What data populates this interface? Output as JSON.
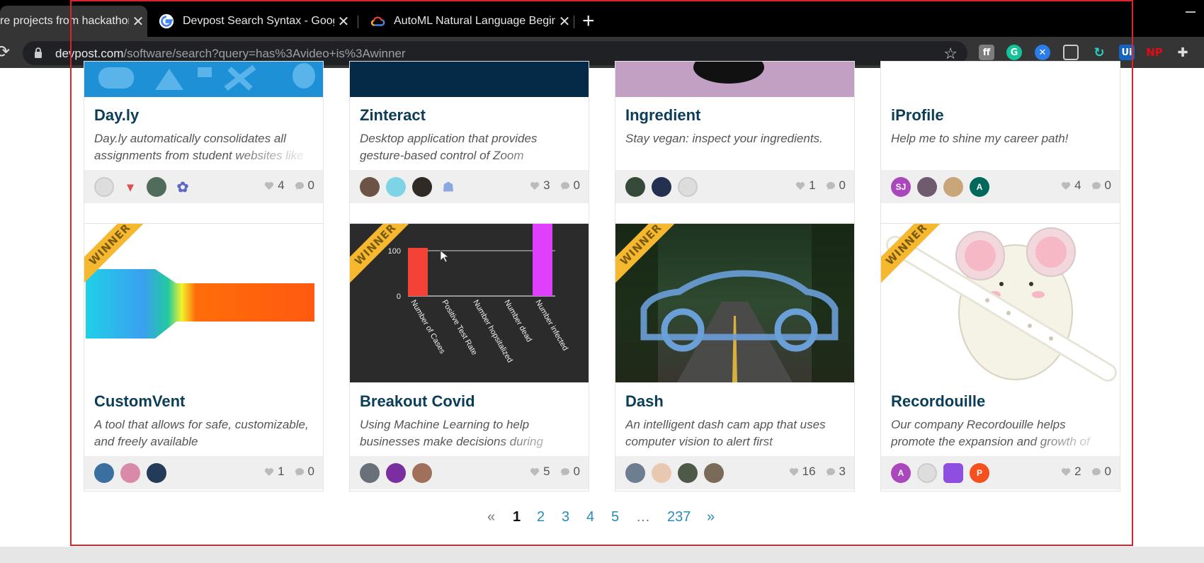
{
  "browser": {
    "tabs": [
      {
        "title": "re projects from hackathon",
        "close": "✕"
      },
      {
        "title": "Devpost Search Syntax - Google",
        "close": "✕"
      },
      {
        "title": "AutoML Natural Language Beginner",
        "close": "✕"
      }
    ],
    "new_tab": "+",
    "url_host": "devpost.com",
    "url_path": "/software/search?query=has%3Avideo+is%3Awinner",
    "extensions": [
      "hackathon-ext-icon",
      "grammarly-icon",
      "x-extension-icon",
      "wallet-icon",
      "sync-icon",
      "ui-ext-icon",
      "netflix-party-icon",
      "puzzle-icon"
    ],
    "ext_labels": {
      "ui": "Ui",
      "np": "NP"
    }
  },
  "ribbon_text": "WINNER",
  "projects": [
    {
      "title": "Day.ly",
      "tagline": "Day.ly automatically consolidates all assignments from student websites like",
      "likes": "4",
      "comments": "0",
      "winner": false
    },
    {
      "title": "Zinteract",
      "tagline": "Desktop application that provides gesture-based control of Zoom",
      "likes": "3",
      "comments": "0",
      "winner": false
    },
    {
      "title": "Ingredient",
      "tagline": "Stay vegan: inspect your ingredients.",
      "likes": "1",
      "comments": "0",
      "winner": false
    },
    {
      "title": "iProfile",
      "tagline": "Help me to shine my career path!",
      "likes": "4",
      "comments": "0",
      "winner": false,
      "avatar_initials": [
        "SJ",
        "A"
      ]
    },
    {
      "title": "CustomVent",
      "tagline": "A tool that allows for safe, customizable, and freely available",
      "likes": "1",
      "comments": "0",
      "winner": true
    },
    {
      "title": "Breakout Covid",
      "tagline": "Using Machine Learning to help businesses make decisions during",
      "likes": "5",
      "comments": "0",
      "winner": true
    },
    {
      "title": "Dash",
      "tagline": "An intelligent dash cam app that uses computer vision to alert first",
      "likes": "16",
      "comments": "3",
      "winner": true
    },
    {
      "title": "Recordouille",
      "tagline": "Our company Recordouille helps promote the expansion and growth of",
      "likes": "2",
      "comments": "0",
      "winner": true,
      "avatar_initials": [
        "A",
        "P"
      ]
    }
  ],
  "covid_chart": {
    "y_ticks": [
      "100",
      "0"
    ],
    "x_labels": [
      "Number of Cases",
      "Positive Test Rate",
      "Number hopsitalized",
      "Number dead",
      "Number infected"
    ],
    "bar_colors": [
      "#f44336",
      "#e040fb"
    ]
  },
  "pagination": {
    "prev": "«",
    "pages": [
      "1",
      "2",
      "3",
      "4",
      "5"
    ],
    "ellipsis": "…",
    "last": "237",
    "next": "»",
    "current": "1"
  }
}
